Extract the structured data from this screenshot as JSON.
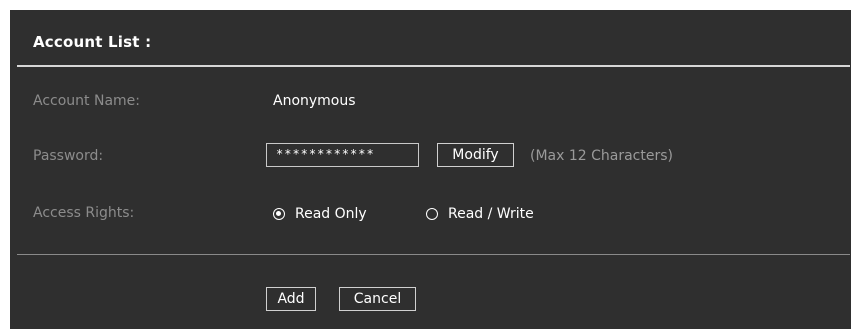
{
  "header": {
    "title": "Account List :"
  },
  "form": {
    "account_name_label": "Account Name:",
    "account_name_value": "Anonymous",
    "password_label": "Password:",
    "password_value": "************",
    "modify_label": "Modify",
    "password_hint": "(Max 12 Characters)",
    "access_rights_label": "Access Rights:",
    "access_options": [
      {
        "label": "Read Only",
        "selected": true
      },
      {
        "label": "Read / Write",
        "selected": false
      }
    ]
  },
  "actions": {
    "add_label": "Add",
    "cancel_label": "Cancel"
  },
  "colors": {
    "panel_bg": "#2f2f2f",
    "label_text": "#8c8c8c",
    "value_text": "#ffffff"
  }
}
